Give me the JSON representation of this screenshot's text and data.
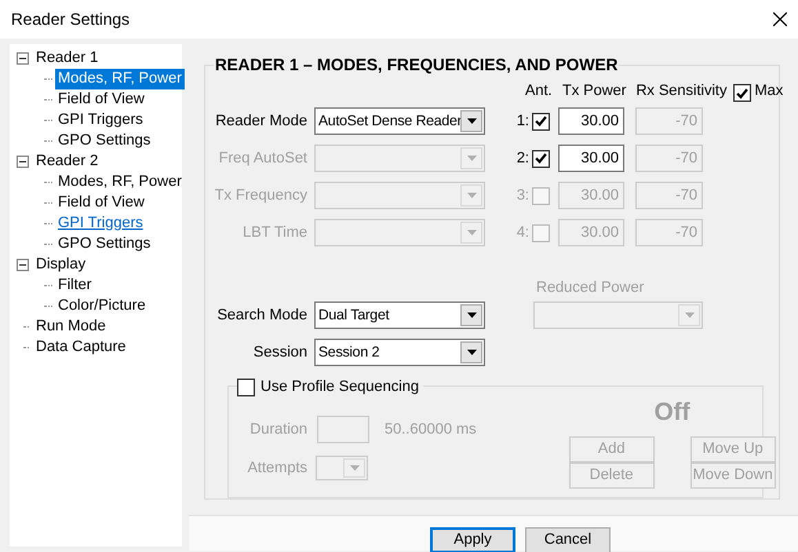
{
  "window": {
    "title": "Reader Settings"
  },
  "tree": [
    {
      "label": "Reader 1",
      "selected": false,
      "hovered": false,
      "expanded": true,
      "children": [
        {
          "label": "Modes, RF, Power",
          "selected": true,
          "hovered": false
        },
        {
          "label": "Field of View",
          "selected": false,
          "hovered": false
        },
        {
          "label": "GPI Triggers",
          "selected": false,
          "hovered": false
        },
        {
          "label": "GPO Settings",
          "selected": false,
          "hovered": false
        }
      ]
    },
    {
      "label": "Reader 2",
      "selected": false,
      "hovered": false,
      "expanded": true,
      "children": [
        {
          "label": "Modes, RF, Power",
          "selected": false,
          "hovered": false
        },
        {
          "label": "Field of View",
          "selected": false,
          "hovered": false
        },
        {
          "label": "GPI Triggers",
          "selected": false,
          "hovered": true
        },
        {
          "label": "GPO Settings",
          "selected": false,
          "hovered": false
        }
      ]
    },
    {
      "label": "Display",
      "selected": false,
      "hovered": false,
      "expanded": true,
      "children": [
        {
          "label": "Filter",
          "selected": false,
          "hovered": false
        },
        {
          "label": "Color/Picture",
          "selected": false,
          "hovered": false
        }
      ]
    },
    {
      "label": "Run Mode",
      "selected": false,
      "hovered": false
    },
    {
      "label": "Data Capture",
      "selected": false,
      "hovered": false
    }
  ],
  "group_title": "READER 1 – MODES, FREQUENCIES, AND POWER",
  "antenna_header": {
    "ant": "Ant.",
    "tx_power": "Tx Power",
    "rx_sensitivity": "Rx Sensitivity",
    "max": {
      "label": "Max",
      "checked": true
    }
  },
  "fields": [
    {
      "label": "Reader Mode",
      "value": "AutoSet Dense Reader",
      "disabled": false
    },
    {
      "label": "Freq AutoSet",
      "disabled": true
    },
    {
      "label": "Tx Frequency",
      "disabled": true
    },
    {
      "label": "LBT Time",
      "disabled": true
    }
  ],
  "antennas": [
    {
      "number": "1:",
      "checked": true,
      "tx_power": "30.00",
      "rx_sensitivity": "-70"
    },
    {
      "number": "2:",
      "checked": true,
      "tx_power": "30.00",
      "rx_sensitivity": "-70"
    },
    {
      "number": "3:",
      "checked": false,
      "tx_power": "30.00",
      "rx_sensitivity": "-70"
    },
    {
      "number": "4:",
      "checked": false,
      "tx_power": "30.00",
      "rx_sensitivity": "-70"
    }
  ],
  "reduced_power": {
    "label": "Reduced Power",
    "disabled": true
  },
  "search_mode": {
    "label": "Search Mode",
    "value": "Dual Target",
    "disabled": false
  },
  "session": {
    "label": "Session",
    "value": "Session 2",
    "disabled": false
  },
  "profile_sequencing": {
    "label": "Use Profile Sequencing",
    "checked": false,
    "status": "Off",
    "duration": {
      "label": "Duration",
      "hint": "50..60000 ms"
    },
    "attempts": {
      "label": "Attempts"
    },
    "buttons": [
      "Add",
      "Move Up",
      "Delete",
      "Move Down"
    ]
  },
  "footer_buttons": [
    "Apply",
    "Cancel"
  ]
}
